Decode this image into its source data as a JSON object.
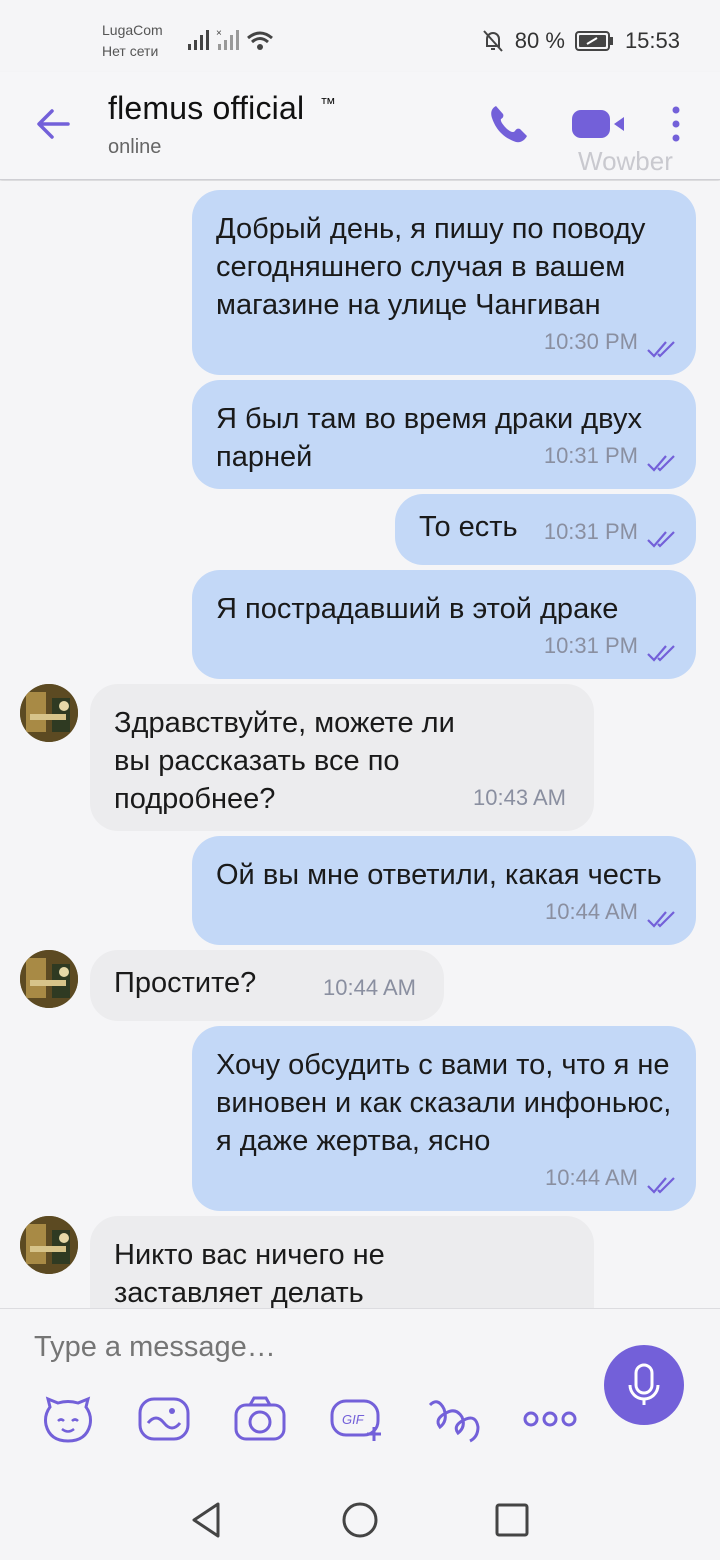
{
  "status_bar": {
    "carrier": "LugaCom",
    "network": "Нет сети",
    "battery": "80 %",
    "time": "15:53"
  },
  "header": {
    "title": "flemus official",
    "title_mark": "™",
    "subtitle": "online",
    "watermark": "Wowber"
  },
  "messages": [
    {
      "dir": "out",
      "text": "Добрый день, я пишу по поводу сегодняшнего случая в вашем магазине на улице Чангиван",
      "time": "10:30 PM"
    },
    {
      "dir": "out",
      "text": "Я был там во время драки двух парней",
      "time": "10:31 PM"
    },
    {
      "dir": "out",
      "text": "То есть",
      "time": "10:31 PM"
    },
    {
      "dir": "out",
      "text": "Я пострадавший в этой драке",
      "time": "10:31 PM"
    },
    {
      "dir": "in",
      "text": "Здравствуйте, можете ли вы рассказать все по подробнее?",
      "time": "10:43 AM"
    },
    {
      "dir": "out",
      "text": "Ой вы мне ответили, какая честь",
      "time": "10:44 AM"
    },
    {
      "dir": "in",
      "text": "Простите?",
      "time": "10:44 AM"
    },
    {
      "dir": "out",
      "text": "Хочу обсудить с вами то, что я не виновен и как сказали инфоньюс, я даже жертва, ясно",
      "time": "10:44 AM"
    },
    {
      "dir": "in",
      "text": "Никто вас ничего не заставляет делать",
      "time": ""
    }
  ],
  "composer": {
    "placeholder": "Type a message…",
    "tools": [
      "sticker-icon",
      "doodle-icon",
      "camera-icon",
      "gif-icon",
      "scribble-icon",
      "more-icon"
    ],
    "gif_label": "GIF"
  },
  "colors": {
    "accent": "#7360d9",
    "outgoing_bubble": "#c3d8f7",
    "incoming_bubble": "#ececee"
  }
}
